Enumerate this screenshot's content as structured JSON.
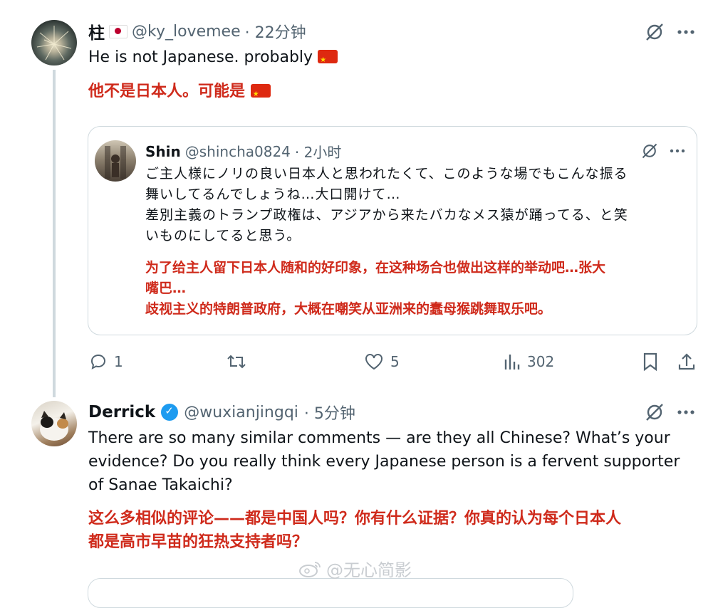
{
  "tweet1": {
    "display_name": "柱",
    "handle": "@ky_lovemee",
    "time": "· 22分钟",
    "text": "He is not Japanese. probably",
    "translation": "他不是日本人。可能是",
    "quote": {
      "display_name": "Shin",
      "handle": "@shincha0824",
      "time": "· 2小时",
      "text_lines": [
        "ご主人様にノリの良い日本人と思われたくて、このような場でもこんな振る",
        "舞いしてるんでしょうね…大口開けて…",
        "差別主義のトランプ政権は、アジアから来たバカなメス猿が踊ってる、と笑",
        "いものにしてると思う。"
      ],
      "translation_lines": [
        "为了给主人留下日本人随和的好印象，在这种场合也做出这样的举动吧…张大",
        "嘴巴…",
        "歧视主义的特朗普政府，大概在嘲笑从亚洲来的蠢母猴跳舞取乐吧。"
      ]
    },
    "actions": {
      "reply_count": "1",
      "repost_count": "",
      "like_count": "5",
      "view_count": "302"
    }
  },
  "tweet2": {
    "display_name": "Derrick",
    "handle": "@wuxianjingqi",
    "time": "· 5分钟",
    "text_lines": [
      "There are so many similar comments — are they all Chinese? What’s your",
      "evidence? Do you really think every Japanese person is a fervent supporter",
      "of Sanae Takaichi?"
    ],
    "translation_lines": [
      "这么多相似的评论——都是中国人吗？你有什么证据？你真的认为每个日本人",
      "都是高市早苗的狂热支持者吗？"
    ]
  },
  "watermark": "@无心简影",
  "colors": {
    "accent": "#1d9bf0",
    "translation": "#cf2a1b",
    "muted": "#536471",
    "border": "#cfd9de"
  }
}
